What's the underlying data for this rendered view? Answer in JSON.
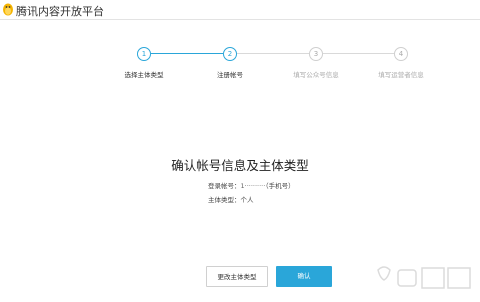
{
  "header": {
    "brand": "腾讯内容开放平台"
  },
  "steps": [
    {
      "number": "1",
      "label": "选择主体类型",
      "state": "done"
    },
    {
      "number": "2",
      "label": "注册帐号",
      "state": "active"
    },
    {
      "number": "3",
      "label": "填写公众号信息",
      "state": "inactive"
    },
    {
      "number": "4",
      "label": "填写运营者信息",
      "state": "inactive"
    }
  ],
  "main": {
    "title": "确认帐号信息及主体类型",
    "account_label": "登录帐号：",
    "account_value": "1··········",
    "account_suffix": "（手机号）",
    "type_label": "主体类型：",
    "type_value": "个人"
  },
  "buttons": {
    "change_type": "更改主体类型",
    "confirm": "确认"
  },
  "colors": {
    "accent": "#2aa6d9",
    "inactive": "#cfcfcf"
  }
}
